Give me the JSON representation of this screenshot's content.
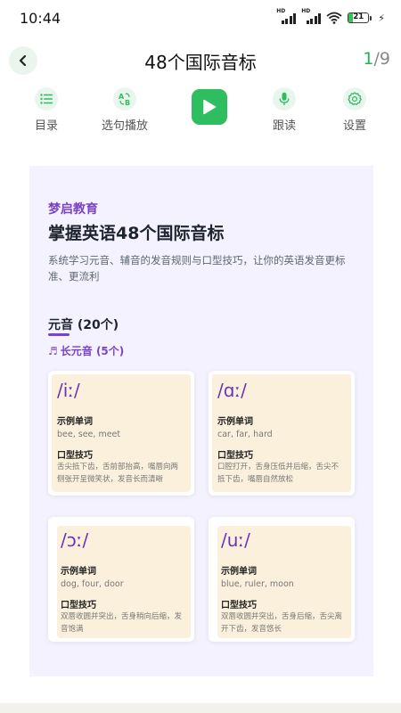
{
  "status_bar": {
    "time": "10:44",
    "network_badge_1": "HD",
    "network_badge_2": "HD",
    "battery_level": "21",
    "battery_fill_fraction": 0.21,
    "colors": {
      "battery_fill": "#35c25a"
    }
  },
  "header": {
    "title": "48个国际音标",
    "page_current": "1",
    "page_total": "/9",
    "back_icon": "chevron-left-icon"
  },
  "toolbar": {
    "items": [
      {
        "label": "目录",
        "icon": "list-icon"
      },
      {
        "label": "选句播放",
        "icon": "ab-icon"
      },
      {
        "label": "跟读",
        "icon": "microphone-icon"
      },
      {
        "label": "设置",
        "icon": "gear-icon"
      }
    ],
    "play_icon": "play-icon",
    "accent_color": "#2ebd5f"
  },
  "content": {
    "brand": "梦启教育",
    "title": "掌握英语48个国际音标",
    "description": "系统学习元音、辅音的发音规则与口型技巧，让你的英语发音更标准、更流利",
    "section_title": "元音 (20个)",
    "sub_section_title": "长元音 (5个)",
    "sub_section_icon": "music-note-icon",
    "card_example_label": "示例单词",
    "card_tip_label": "口型技巧",
    "cards": [
      {
        "symbol": "/iː/",
        "examples": "bee, see, meet",
        "tip": "舌尖抵下齿，舌前部抬高，嘴唇向两侧张开呈微笑状，发音长而清晰"
      },
      {
        "symbol": "/ɑː/",
        "examples": "car, far, hard",
        "tip": "口腔打开，舌身压低并后缩，舌尖不抵下齿，嘴唇自然放松"
      },
      {
        "symbol": "/ɔː/",
        "examples": "dog, four, door",
        "tip": "双唇收圆并突出，舌身稍向后缩，发音饱满"
      },
      {
        "symbol": "/uː/",
        "examples": "blue, ruler, moon",
        "tip": "双唇收圆并突出，舌身后缩，舌尖离开下齿，发音悠长"
      }
    ],
    "colors": {
      "brand": "#7a43c8",
      "panel_bg": "#f4f2fe",
      "card_bg": "#fbf0db"
    }
  }
}
